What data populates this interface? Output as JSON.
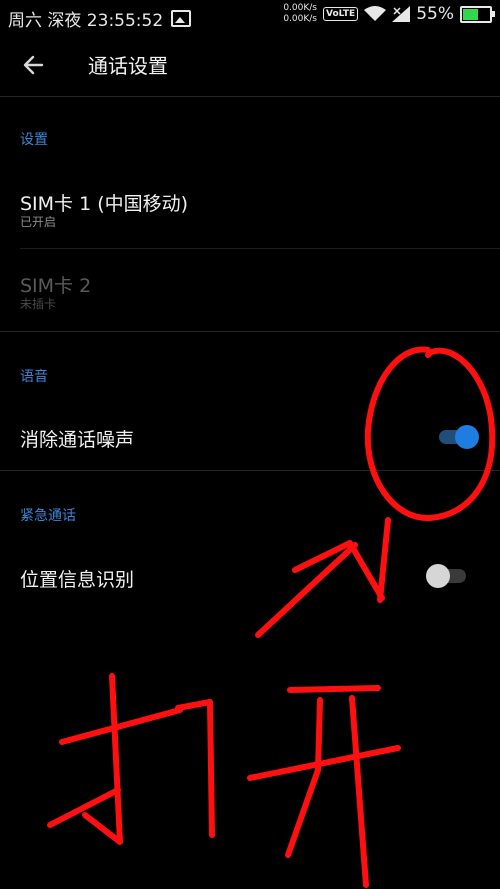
{
  "status_bar": {
    "time": "周六 深夜 23:55:52",
    "upload_speed": "0.00K/s",
    "download_speed": "0.00K/s",
    "volte": "VoLTE",
    "battery": "55%"
  },
  "header": {
    "title": "通话设置"
  },
  "sections": {
    "settings": {
      "label": "设置",
      "sim1_title": "SIM卡 1 (中国移动)",
      "sim1_status": "已开启",
      "sim2_title": "SIM卡 2",
      "sim2_status": "未插卡"
    },
    "voice": {
      "label": "语音",
      "noise_title": "消除通话噪声",
      "noise_on": true
    },
    "emergency": {
      "label": "紧急通话",
      "location_title": "位置信息识别",
      "location_on": false
    }
  },
  "annotation": {
    "text": "打开",
    "color": "#ff0000"
  },
  "colors": {
    "accent": "#3a86d6",
    "switch_on": "#1f7de0"
  }
}
